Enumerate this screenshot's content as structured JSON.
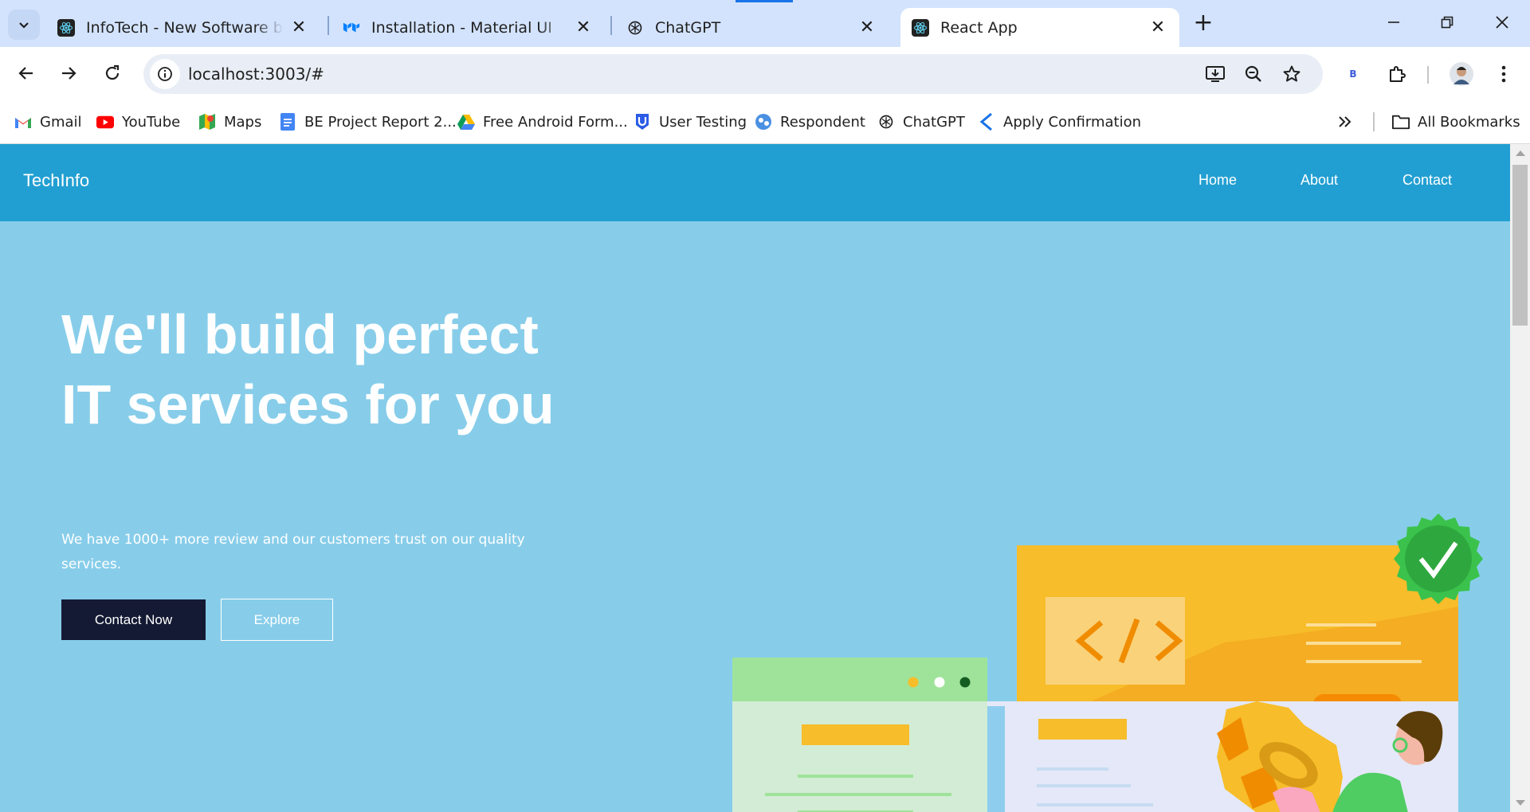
{
  "browser": {
    "tabs": [
      {
        "title": "InfoTech - New Software buying",
        "icon": "react-icon",
        "active": false
      },
      {
        "title": "Installation - Material UI",
        "icon": "mui-icon",
        "active": false
      },
      {
        "title": "ChatGPT",
        "icon": "chatgpt-icon",
        "active": false
      },
      {
        "title": "React App",
        "icon": "react-icon",
        "active": true
      }
    ],
    "url": "localhost:3003/#",
    "profile_badge": "B",
    "bookmarks": [
      {
        "label": "Gmail",
        "icon": "gmail-icon"
      },
      {
        "label": "YouTube",
        "icon": "youtube-icon"
      },
      {
        "label": "Maps",
        "icon": "maps-icon"
      },
      {
        "label": "BE Project Report 2...",
        "icon": "docs-icon"
      },
      {
        "label": "Free Android Form...",
        "icon": "drive-icon"
      },
      {
        "label": "User Testing",
        "icon": "usertesting-icon"
      },
      {
        "label": "Respondent",
        "icon": "respondent-icon"
      },
      {
        "label": "ChatGPT",
        "icon": "chatgpt-icon"
      },
      {
        "label": "Apply Confirmation",
        "icon": "apply-icon"
      }
    ],
    "all_bookmarks": "All Bookmarks"
  },
  "site": {
    "brand": "TechInfo",
    "nav": {
      "home": "Home",
      "about": "About",
      "contact": "Contact"
    },
    "hero": {
      "title": "We'll build perfect IT services for you",
      "subtitle": "We have 1000+ more review and our customers trust on our quality services.",
      "primary_button": "Contact Now",
      "secondary_button": "Explore"
    }
  },
  "colors": {
    "navbar": "#229fd2",
    "hero_background": "#87cdea",
    "primary_button": "#141a33",
    "illustration_yellow": "#f7bd2a",
    "illustration_green": "#4fcc62"
  }
}
